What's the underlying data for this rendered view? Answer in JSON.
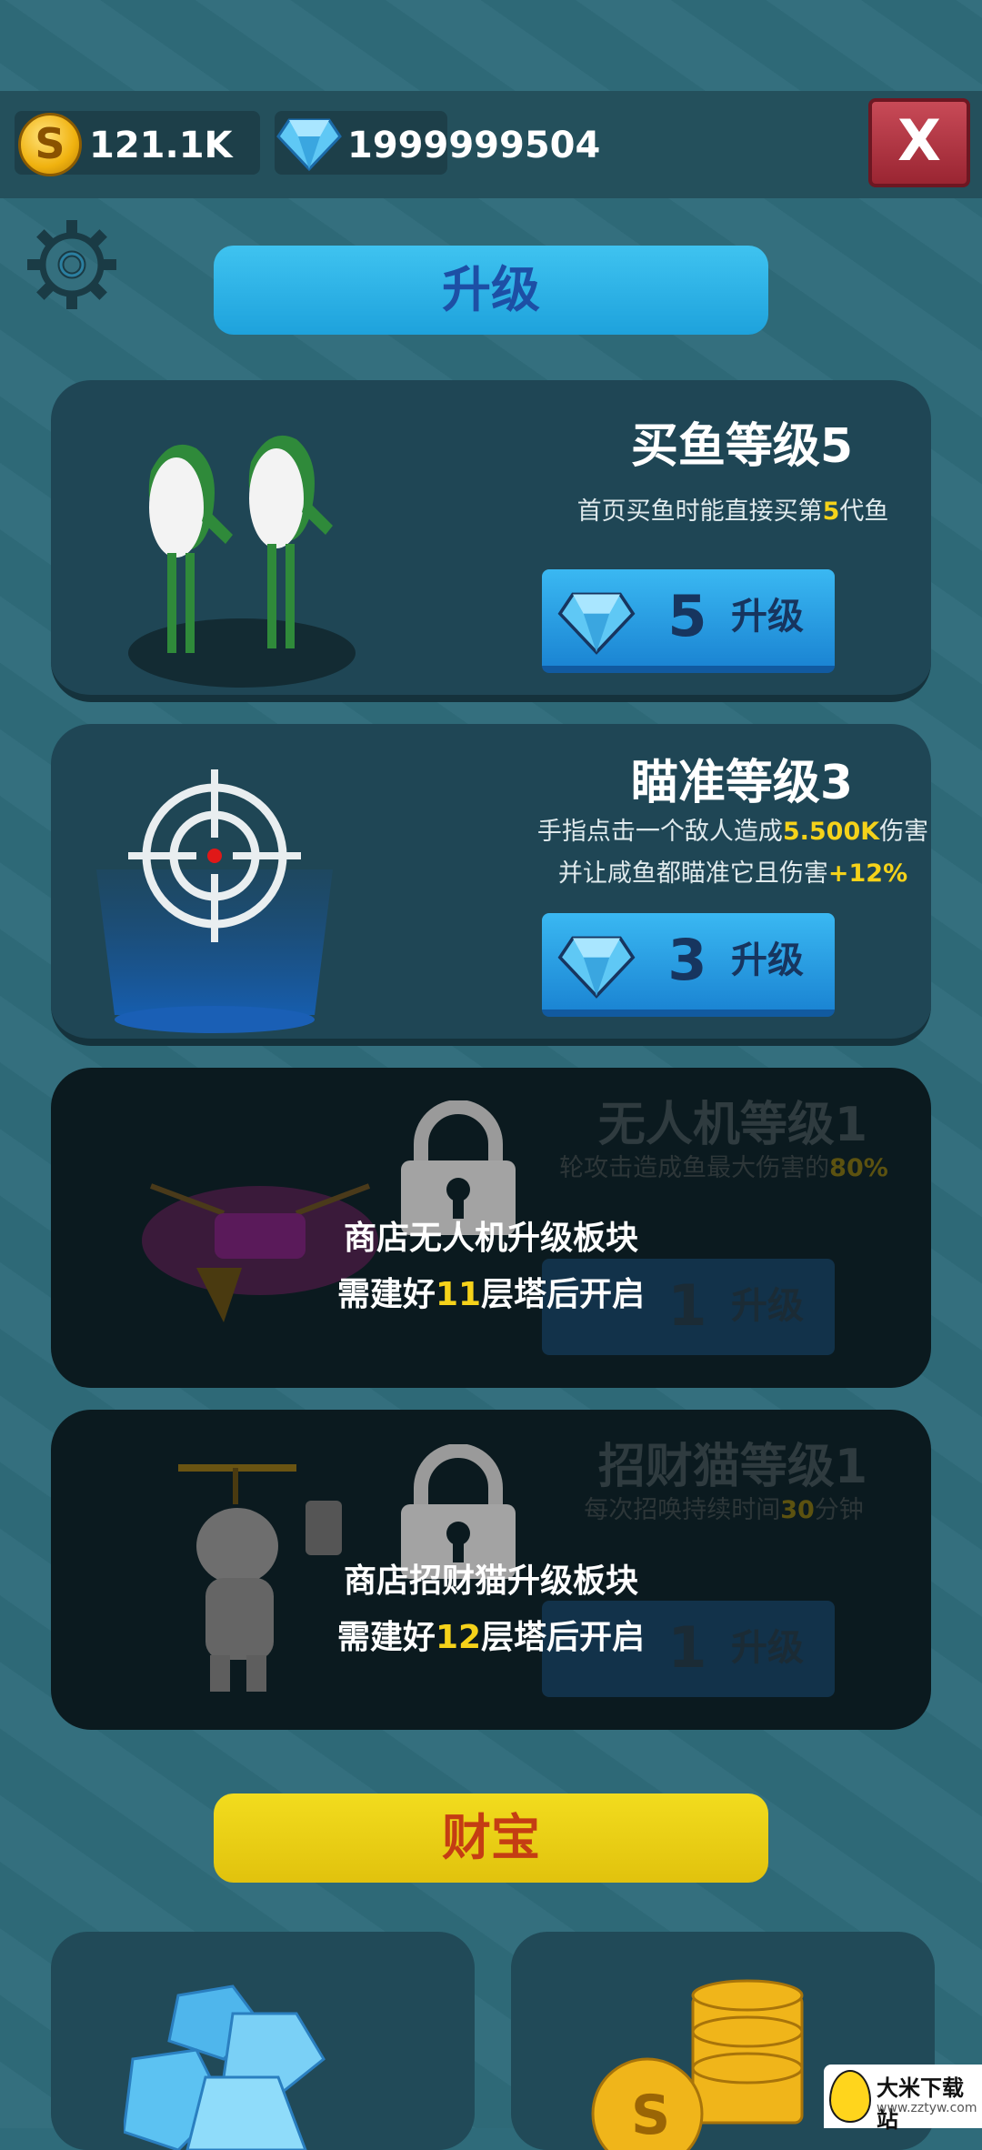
{
  "currency": {
    "coins": "121.1K",
    "coin_symbol": "S",
    "gems": "1999999504"
  },
  "header": {
    "close_label": "X"
  },
  "sections": {
    "upgrade_title": "升级",
    "treasure_title": "财宝"
  },
  "upgrades": [
    {
      "title": "买鱼等级5",
      "desc": [
        "首页买鱼时能直接买第",
        "5",
        "代鱼"
      ],
      "cost": "5",
      "button_label": "升级"
    },
    {
      "title": "瞄准等级3",
      "desc1": [
        "手指点击一个敌人造成",
        "5.500K",
        "伤害"
      ],
      "desc2": [
        "并让咸鱼都瞄准它且伤害",
        "+12%"
      ],
      "cost": "3",
      "button_label": "升级"
    }
  ],
  "locked": [
    {
      "title": "无人机等级1",
      "desc": [
        "轮攻击造成鱼最大伤害的",
        "80%"
      ],
      "cost": "1",
      "button_label": "升级",
      "line1": "商店无人机升级板块",
      "line2": [
        "需建好",
        "11",
        "层塔后开启"
      ]
    },
    {
      "title": "招财猫等级1",
      "desc": [
        "每次招唤持续时间",
        "30",
        "分钟"
      ],
      "cost": "1",
      "button_label": "升级",
      "line1": "商店招财猫升级板块",
      "line2": [
        "需建好",
        "12",
        "层塔后开启"
      ]
    }
  ],
  "watermark": {
    "name": "大米下载站",
    "url": "www.zztyw.com"
  },
  "colors": {
    "accent_blue": "#1ea2dc",
    "accent_yellow": "#e1c20d",
    "highlight": "#f5d21a"
  }
}
